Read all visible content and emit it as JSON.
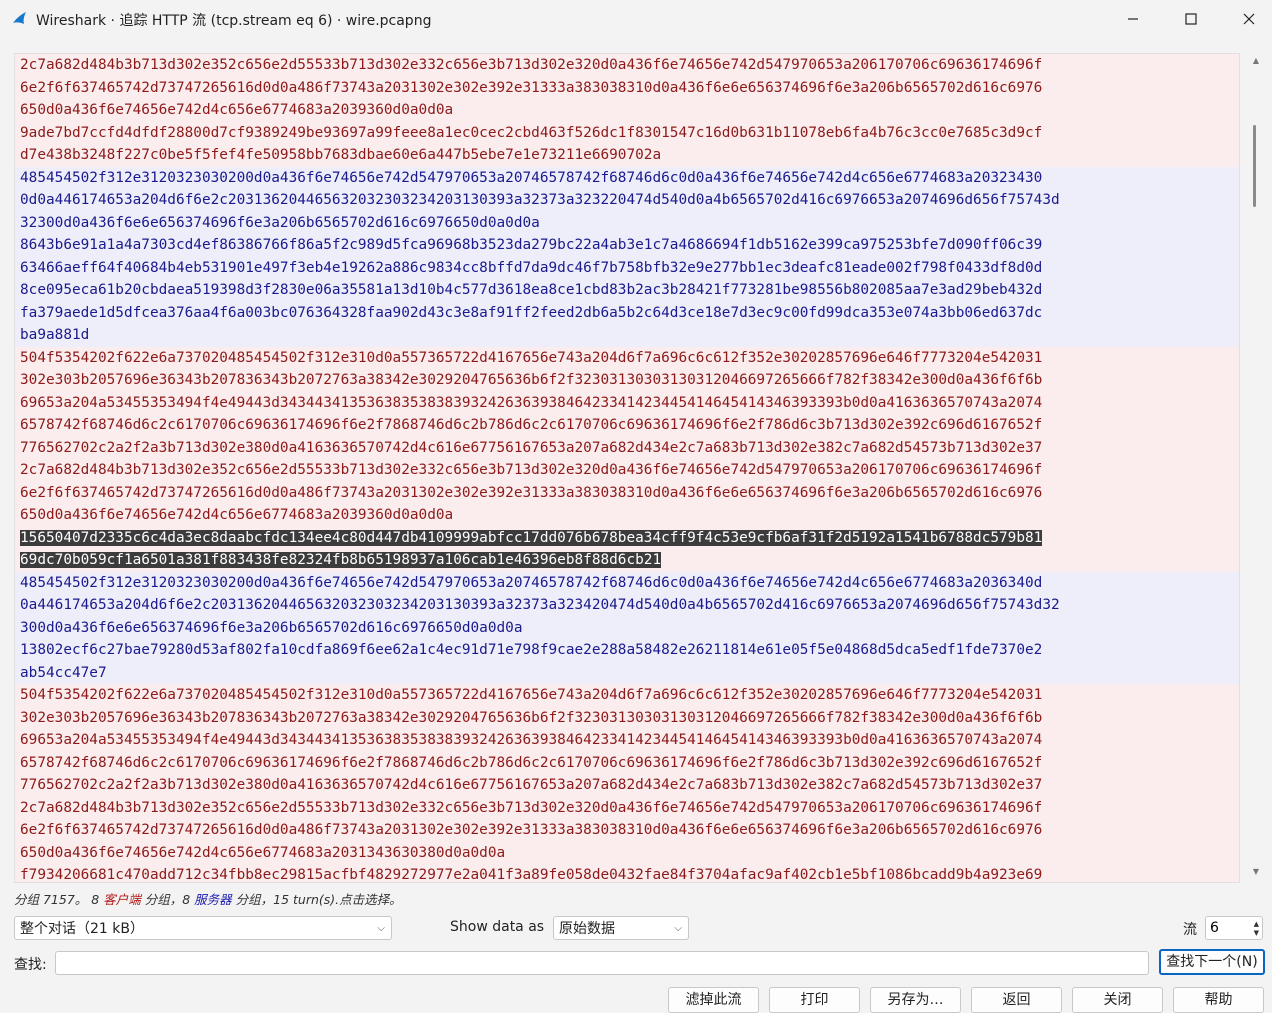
{
  "window": {
    "title": "Wireshark · 追踪 HTTP 流 (tcp.stream eq 6) · wire.pcapng"
  },
  "stream": {
    "lines": [
      {
        "dir": "client",
        "text": "2c7a682d484b3b713d302e352c656e2d55533b713d302e332c656e3b713d302e320d0a436f6e74656e742d547970653a206170706c69636174696f"
      },
      {
        "dir": "client",
        "text": "6e2f6f637465742d73747265616d0d0a486f73743a2031302e302e392e31333a383038310d0a436f6e6e656374696f6e3a206b6565702d616c6976"
      },
      {
        "dir": "client",
        "text": "650d0a436f6e74656e742d4c656e6774683a2039360d0a0d0a"
      },
      {
        "dir": "client",
        "text": "9ade7bd7ccfd4dfdf28800d7cf9389249be93697a99feee8a1ec0cec2cbd463f526dc1f8301547c16d0b631b11078eb6fa4b76c3cc0e7685c3d9cf"
      },
      {
        "dir": "client",
        "text": "d7e438b3248f227c0be5f5fef4fe50958bb7683dbae60e6a447b5ebe7e1e73211e6690702a"
      },
      {
        "dir": "server",
        "text": "485454502f312e3120323030200d0a436f6e74656e742d547970653a20746578742f68746d6c0d0a436f6e74656e742d4c656e6774683a20323430"
      },
      {
        "dir": "server",
        "text": "0d0a446174653a204d6f6e2c203136204465632032303234203130393a32373a323220474d540d0a4b6565702d416c6976653a2074696d656f75743d"
      },
      {
        "dir": "server",
        "text": "32300d0a436f6e6e656374696f6e3a206b6565702d616c6976650d0a0d0a"
      },
      {
        "dir": "server",
        "text": "8643b6e91a1a4a7303cd4ef86386766f86a5f2c989d5fca96968b3523da279bc22a4ab3e1c7a4686694f1db5162e399ca975253bfe7d090ff06c39"
      },
      {
        "dir": "server",
        "text": "63466aeff64f40684b4eb531901e497f3eb4e19262a886c9834cc8bffd7da9dc46f7b758bfb32e9e277bb1ec3deafc81eade002f798f0433df8d0d"
      },
      {
        "dir": "server",
        "text": "8ce095eca61b20cbdaea519398d3f2830e06a35581a13d10b4c577d3618ea8ce1cbd83b2ac3b28421f773281be98556b802085aa7e3ad29beb432d"
      },
      {
        "dir": "server",
        "text": "fa379aede1d5dfcea376aa4f6a003bc076364328faa902d43c3e8af91ff2feed2db6a5b2c64d3ce18e7d3ec9c00fd99dca353e074a3bb06ed637dc"
      },
      {
        "dir": "server",
        "text": "ba9a881d"
      },
      {
        "dir": "client",
        "text": "504f5354202f622e6a737020485454502f312e310d0a557365722d4167656e743a204d6f7a696c6c612f352e30202857696e646f7773204e542031"
      },
      {
        "dir": "client",
        "text": "302e303b2057696e36343b207836343b2072763a38342e3029204765636b6f2f32303130303130312046697265666f782f38342e300d0a436f6f6b"
      },
      {
        "dir": "client",
        "text": "69653a204a53455353494f4e49443d34344341353638353838393242636393846423341423445414645414346393393b0d0a4163636570743a2074"
      },
      {
        "dir": "client",
        "text": "6578742f68746d6c2c6170706c69636174696f6e2f7868746d6c2b786d6c2c6170706c69636174696f6e2f786d6c3b713d302e392c696d6167652f"
      },
      {
        "dir": "client",
        "text": "776562702c2a2f2a3b713d302e380d0a4163636570742d4c616e67756167653a207a682d434e2c7a683b713d302e382c7a682d54573b713d302e37"
      },
      {
        "dir": "client",
        "text": "2c7a682d484b3b713d302e352c656e2d55533b713d302e332c656e3b713d302e320d0a436f6e74656e742d547970653a206170706c69636174696f"
      },
      {
        "dir": "client",
        "text": "6e2f6f637465742d73747265616d0d0a486f73743a2031302e302e392e31333a383038310d0a436f6e6e656374696f6e3a206b6565702d616c6976"
      },
      {
        "dir": "client",
        "text": "650d0a436f6e74656e742d4c656e6774683a2039360d0a0d0a"
      },
      {
        "dir": "client",
        "text": "15650407d2335c6c4da3ec8daabcfdc134ee4c80d447db4109999abfcc17dd076b678bea34cff9f4c53e9cfb6af31f2d5192a1541b6788dc579b81",
        "hl": true
      },
      {
        "dir": "client",
        "text": "69dc70b059cf1a6501a381f883438fe82324fb8b65198937a106cab1e46396eb8f88d6cb21",
        "hl": true
      },
      {
        "dir": "server",
        "text": "485454502f312e3120323030200d0a436f6e74656e742d547970653a20746578742f68746d6c0d0a436f6e74656e742d4c656e6774683a2036340d"
      },
      {
        "dir": "server",
        "text": "0a446174653a204d6f6e2c203136204465632032303234203130393a32373a323420474d540d0a4b6565702d416c6976653a2074696d656f75743d32"
      },
      {
        "dir": "server",
        "text": "300d0a436f6e6e656374696f6e3a206b6565702d616c6976650d0a0d0a"
      },
      {
        "dir": "server",
        "text": "13802ecf6c27bae79280d53af802fa10cdfa869f6ee62a1c4ec91d71e798f9cae2e288a58482e26211814e61e05f5e04868d5dca5edf1fde7370e2"
      },
      {
        "dir": "server",
        "text": "ab54cc47e7"
      },
      {
        "dir": "client",
        "text": "504f5354202f622e6a737020485454502f312e310d0a557365722d4167656e743a204d6f7a696c6c612f352e30202857696e646f7773204e542031"
      },
      {
        "dir": "client",
        "text": "302e303b2057696e36343b207836343b2072763a38342e3029204765636b6f2f32303130303130312046697265666f782f38342e300d0a436f6f6b"
      },
      {
        "dir": "client",
        "text": "69653a204a53455353494f4e49443d34344341353638353838393242636393846423341423445414645414346393393b0d0a4163636570743a2074"
      },
      {
        "dir": "client",
        "text": "6578742f68746d6c2c6170706c69636174696f6e2f7868746d6c2b786d6c2c6170706c69636174696f6e2f786d6c3b713d302e392c696d6167652f"
      },
      {
        "dir": "client",
        "text": "776562702c2a2f2a3b713d302e380d0a4163636570742d4c616e67756167653a207a682d434e2c7a683b713d302e382c7a682d54573b713d302e37"
      },
      {
        "dir": "client",
        "text": "2c7a682d484b3b713d302e352c656e2d55533b713d302e332c656e3b713d302e320d0a436f6e74656e742d547970653a206170706c69636174696f"
      },
      {
        "dir": "client",
        "text": "6e2f6f637465742d73747265616d0d0a486f73743a2031302e302e392e31333a383038310d0a436f6e6e656374696f6e3a206b6565702d616c6976"
      },
      {
        "dir": "client",
        "text": "650d0a436f6e74656e742d4c656e6774683a2031343630380d0a0d0a"
      },
      {
        "dir": "client",
        "text": "f7934206681c470add712c34fbb8ec29815acfbf4829272977e2a041f3a89fe058de0432fae84f3704afac9af402cb1e5bf1086bcadd9b4a923e69"
      }
    ]
  },
  "stats": {
    "prefix": "分组 7157。",
    "client_count": "8",
    "client_label": "客户端",
    "mid1": " 分组，",
    "server_count": "8",
    "server_label": "服务器",
    "mid2": " 分组，",
    "turns": "15 turn(s).",
    "hint": "点击选择。"
  },
  "controls": {
    "conversation_value": "整个对话（21 kB）",
    "show_data_label": "Show data as",
    "show_data_value": "原始数据",
    "stream_label": "流",
    "stream_value": "6",
    "find_label": "查找:",
    "find_value": "",
    "find_next_label": "查找下一个(N)"
  },
  "buttons": {
    "filter_out": "滤掉此流",
    "print": "打印",
    "save_as": "另存为…",
    "back": "返回",
    "close": "关闭",
    "help": "帮助"
  },
  "colors": {
    "client_bg": "#fbeded",
    "client_fg": "#8c1a1a",
    "server_bg": "#eeeefb",
    "server_fg": "#1a1a8c",
    "highlight_bg": "#3c3c3c",
    "accent": "#0a66c2"
  }
}
